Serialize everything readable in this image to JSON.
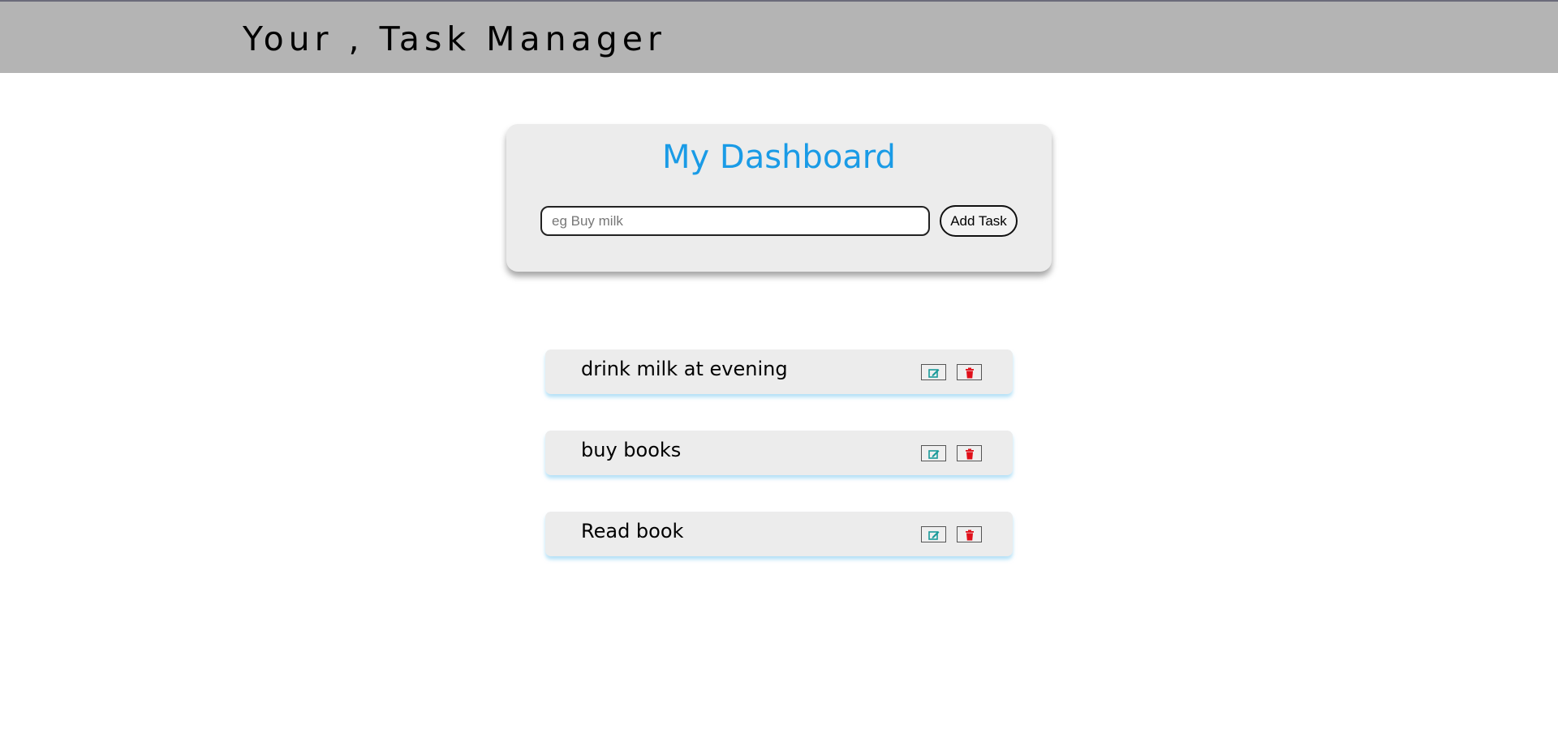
{
  "header": {
    "title": "Your , Task Manager"
  },
  "dashboard": {
    "title": "My Dashboard",
    "input": {
      "placeholder": "eg Buy milk",
      "value": ""
    },
    "add_button_label": "Add Task"
  },
  "tasks": [
    {
      "text": "drink milk at evening"
    },
    {
      "text": "buy books"
    },
    {
      "text": "Read book"
    }
  ],
  "icons": {
    "edit": "edit-icon",
    "delete": "trash-icon"
  },
  "colors": {
    "header_bg": "#b4b4b4",
    "dashboard_title": "#1a9be6",
    "edit_icon": "#1a9a9a",
    "delete_icon": "#e0101a",
    "card_bg": "#ececec"
  }
}
